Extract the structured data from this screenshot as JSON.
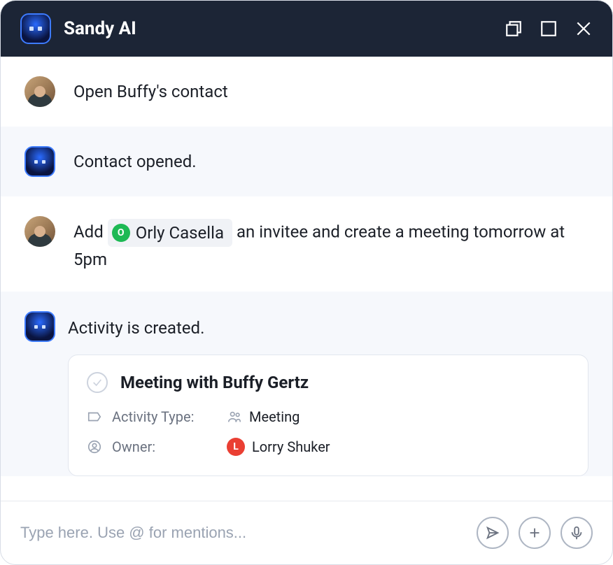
{
  "header": {
    "title": "Sandy AI"
  },
  "messages": [
    {
      "role": "user",
      "text": "Open Buffy's contact"
    },
    {
      "role": "bot",
      "text": "Contact opened."
    },
    {
      "role": "user",
      "prefix": "Add ",
      "mention": {
        "initial": "O",
        "name": "Orly Casella"
      },
      "suffix": " an invitee and create a meeting tomorrow at 5pm"
    },
    {
      "role": "bot",
      "text": "Activity is created.",
      "card": {
        "title": "Meeting with Buffy Gertz",
        "activity_type_label": "Activity Type:",
        "activity_type_value": "Meeting",
        "owner_label": "Owner:",
        "owner_initial": "L",
        "owner_value": "Lorry Shuker"
      }
    }
  ],
  "composer": {
    "placeholder": "Type here. Use @ for mentions..."
  }
}
